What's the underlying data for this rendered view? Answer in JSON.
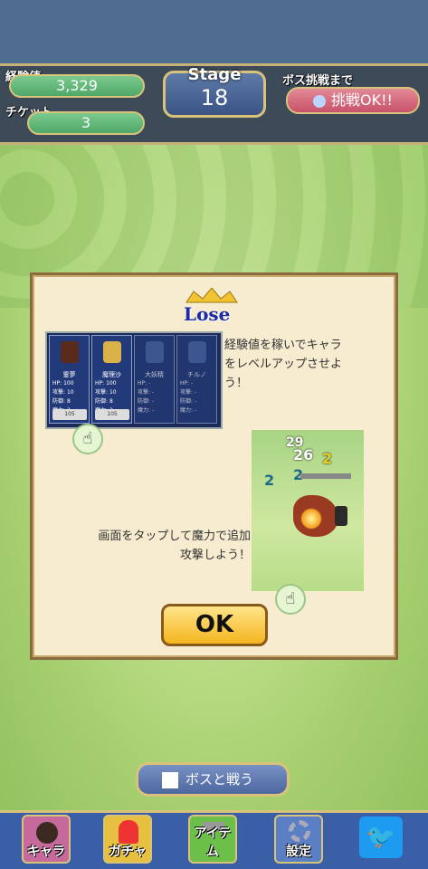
{
  "hud": {
    "exp_label": "経験値",
    "exp_value": "3,329",
    "ticket_label": "チケット",
    "ticket_value": "3",
    "stage_label": "Stage",
    "stage_value": "18",
    "boss_label": "ボス挑戦まで",
    "boss_status": "挑戦OK!!"
  },
  "dialog": {
    "title": "Lose",
    "tip1": "経験値を稼いでキャラをレベルアップさせよう！",
    "tip2": "画面をタップして魔力で追加攻撃しよう！",
    "ok_label": "OK",
    "cards": [
      {
        "name": "霊夢",
        "level": "1",
        "hp": "100",
        "atk": "10",
        "def": "8",
        "mag": "2",
        "lvup": "レベルアップ",
        "cost": "105"
      },
      {
        "name": "魔理沙",
        "level": "1",
        "hp": "100",
        "atk": "10",
        "def": "8",
        "mag": "2",
        "lvup": "レベルアップ",
        "cost": "105"
      },
      {
        "name": "大妖精",
        "level": "",
        "hp": "-",
        "atk": "-",
        "def": "-",
        "mag": "-",
        "lvup": "",
        "cost": ""
      },
      {
        "name": "チルノ",
        "level": "",
        "hp": "-",
        "atk": "-",
        "def": "-",
        "mag": "-",
        "lvup": "",
        "cost": ""
      }
    ],
    "stat_labels": {
      "hp": "HP:",
      "atk": "攻撃:",
      "def": "防御:",
      "mag": "魔力:"
    },
    "damage_numbers": [
      "29",
      "26",
      "2",
      "2",
      "2"
    ]
  },
  "bottom": {
    "boss_fight_label": "ボスと戦う",
    "nav": [
      {
        "label": "キャラ",
        "icon": "character-icon"
      },
      {
        "label": "ガチャ",
        "icon": "gacha-icon"
      },
      {
        "label": "アイテム",
        "icon": "hammer-icon"
      },
      {
        "label": "設定",
        "icon": "gear-icon"
      }
    ],
    "twitter_icon": "twitter-bird-icon"
  }
}
